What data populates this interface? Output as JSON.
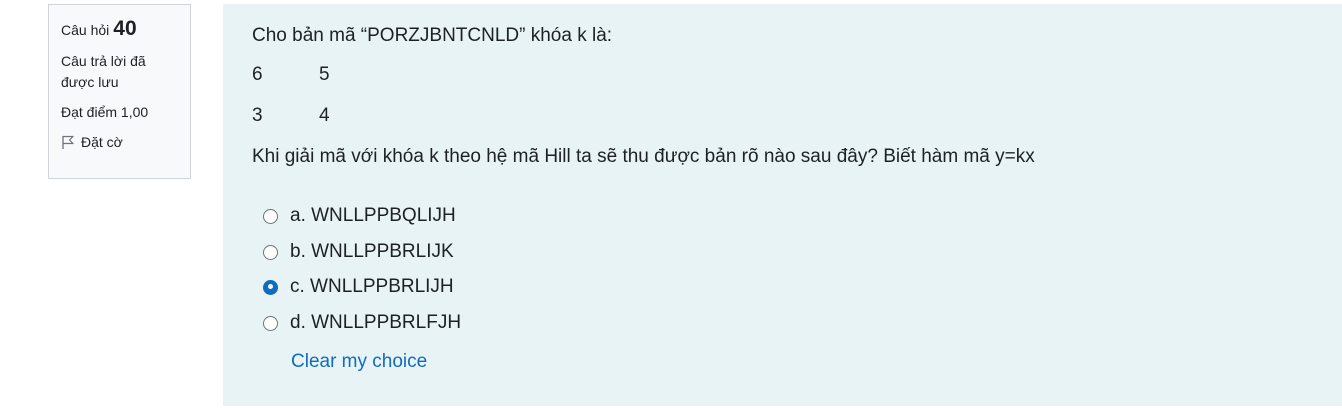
{
  "info": {
    "question_label": "Câu hỏi",
    "question_number": "40",
    "state_line1": "Câu trả lời đã",
    "state_line2": "được lưu",
    "grade": "Đạt điểm 1,00",
    "flag_label": "Đặt cờ"
  },
  "question": {
    "intro": "Cho bản mã “PORZJBNTCNLD” khóa k là:",
    "matrix": [
      [
        "6",
        "5"
      ],
      [
        "3",
        "4"
      ]
    ],
    "prompt": "Khi giải mã với khóa k theo hệ mã Hill ta sẽ thu được bản rõ nào sau đây? Biết hàm mã y=kx"
  },
  "options": [
    {
      "label": "a. WNLLPPBQLIJH",
      "selected": false
    },
    {
      "label": "b. WNLLPPBRLIJK",
      "selected": false
    },
    {
      "label": "c. WNLLPPBRLIJH",
      "selected": true
    },
    {
      "label": "d. WNLLPPBRLFJH",
      "selected": false
    }
  ],
  "clear_choice": "Clear my choice",
  "colors": {
    "accent": "#0f6cbf",
    "panel_bg": "#e7f3f5",
    "info_bg": "#f8f9fa"
  }
}
